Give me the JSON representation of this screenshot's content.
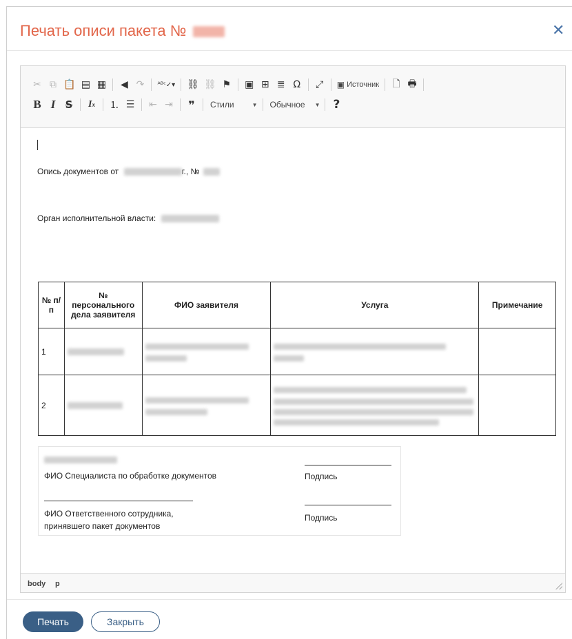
{
  "dialog": {
    "title": "Печать описи пакета №",
    "close_icon": "close-icon"
  },
  "toolbar": {
    "row1": [
      "cut-icon",
      "copy-icon",
      "paste-icon",
      "paste-text-icon",
      "paste-word-icon",
      "undo-icon",
      "redo-icon",
      "spellcheck-icon",
      "link-icon",
      "unlink-icon",
      "anchor-icon",
      "image-icon",
      "table-icon",
      "horizontal-line-icon",
      "special-char-icon",
      "maximize-icon",
      "source-icon",
      "preview-icon",
      "print-icon"
    ],
    "source_label": "Источник",
    "styles_label": "Стили",
    "format_label": "Обычное",
    "help_label": "?"
  },
  "content": {
    "line1_prefix": "Опись документов от",
    "line1_mid": "г., №",
    "line2_label": "Орган исполнительной власти:",
    "table": {
      "headers": [
        "№ п/п",
        "№ персонального дела заявителя",
        "ФИО заявителя",
        "Услуга",
        "Примечание"
      ],
      "rows": [
        {
          "num": "1"
        },
        {
          "num": "2"
        }
      ]
    },
    "signature": {
      "spec_label": "ФИО Специалиста по обработке документов",
      "sign1": "Подпись",
      "resp_label_1": "ФИО Ответственного сотрудника,",
      "resp_label_2": "принявшего пакет документов",
      "sign2": "Подпись"
    }
  },
  "statusbar": {
    "path1": "body",
    "path2": "p"
  },
  "footer": {
    "print_label": "Печать",
    "close_label": "Закрыть"
  }
}
